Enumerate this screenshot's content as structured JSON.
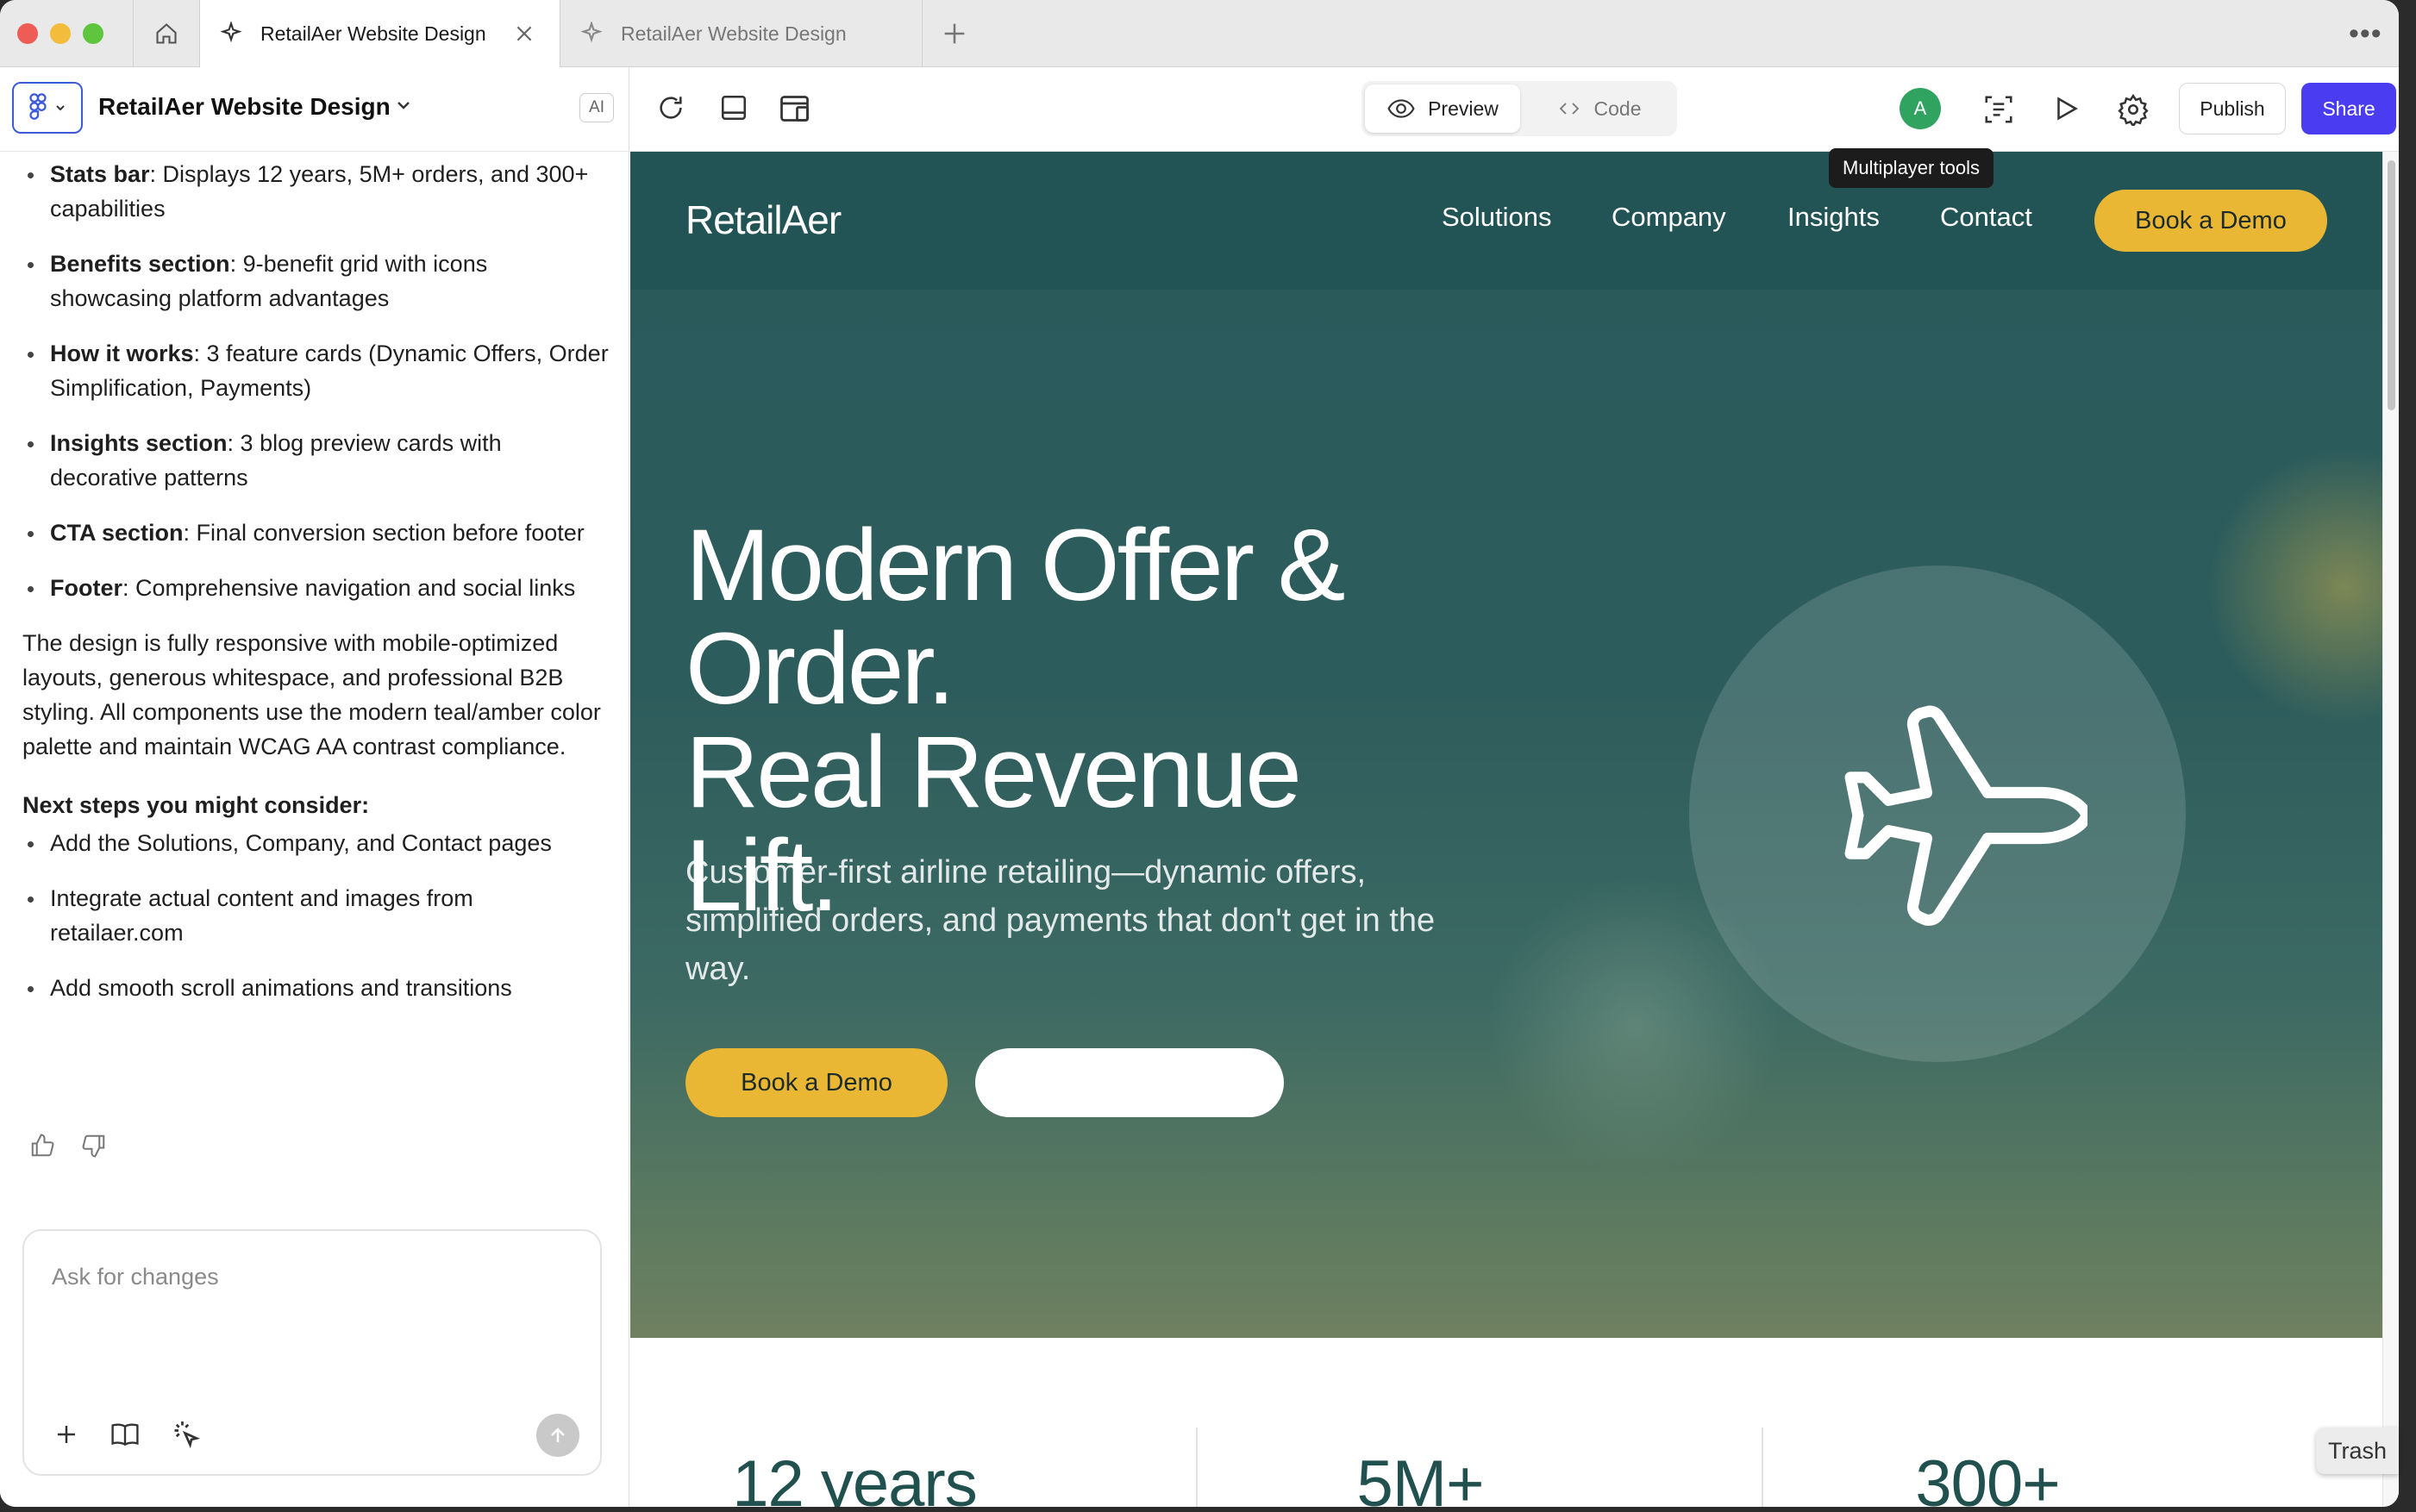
{
  "browser": {
    "tabs": [
      {
        "label": "RetailAer Website Design",
        "active": true
      },
      {
        "label": "RetailAer Website Design",
        "active": false
      }
    ],
    "more_icon": "more-horizontal-icon"
  },
  "left_panel": {
    "project_title": "RetailAer Website Design",
    "ai_badge": "AI",
    "bullets": [
      {
        "bold": "Stats bar",
        "text": ": Displays 12 years, 5M+ orders, and 300+ capabilities"
      },
      {
        "bold": "Benefits section",
        "text": ": 9-benefit grid with icons showcasing platform advantages"
      },
      {
        "bold": "How it works",
        "text": ": 3 feature cards (Dynamic Offers, Order Simplification, Payments)"
      },
      {
        "bold": "Insights section",
        "text": ": 3 blog preview cards with decorative patterns"
      },
      {
        "bold": "CTA section",
        "text": ": Final conversion section before footer"
      },
      {
        "bold": "Footer",
        "text": ": Comprehensive navigation and social links"
      }
    ],
    "summary": "The design is fully responsive with mobile-optimized layouts, generous whitespace, and professional B2B styling. All components use the modern teal/amber color palette and maintain WCAG AA contrast compliance.",
    "next_steps_heading": "Next steps you might consider:",
    "next_steps": [
      "Add the Solutions, Company, and Contact pages",
      "Integrate actual content and images from retailaer.com",
      "Add smooth scroll animations and transitions"
    ],
    "composer_placeholder": "Ask for changes"
  },
  "toolbar": {
    "preview_label": "Preview",
    "code_label": "Code",
    "avatar_initial": "A",
    "tooltip": "Multiplayer tools",
    "publish_label": "Publish",
    "share_label": "Share"
  },
  "site": {
    "logo": "RetailAer",
    "nav": [
      "Solutions",
      "Company",
      "Insights",
      "Contact"
    ],
    "nav_cta": "Book a Demo",
    "headline_line1": "Modern Offer &",
    "headline_line2": "Order.",
    "headline_line3": "Real Revenue Lift.",
    "subheadline": "Customer-first airline retailing—dynamic offers, simplified orders, and payments that don't get in the way.",
    "primary_cta": "Book a Demo",
    "stats": [
      "12 years",
      "5M+",
      "300+"
    ],
    "colors": {
      "teal": "#2a5a5b",
      "amber": "#e9b733",
      "stat_text": "#21514f"
    }
  },
  "dock": {
    "trash_label": "Trash"
  }
}
